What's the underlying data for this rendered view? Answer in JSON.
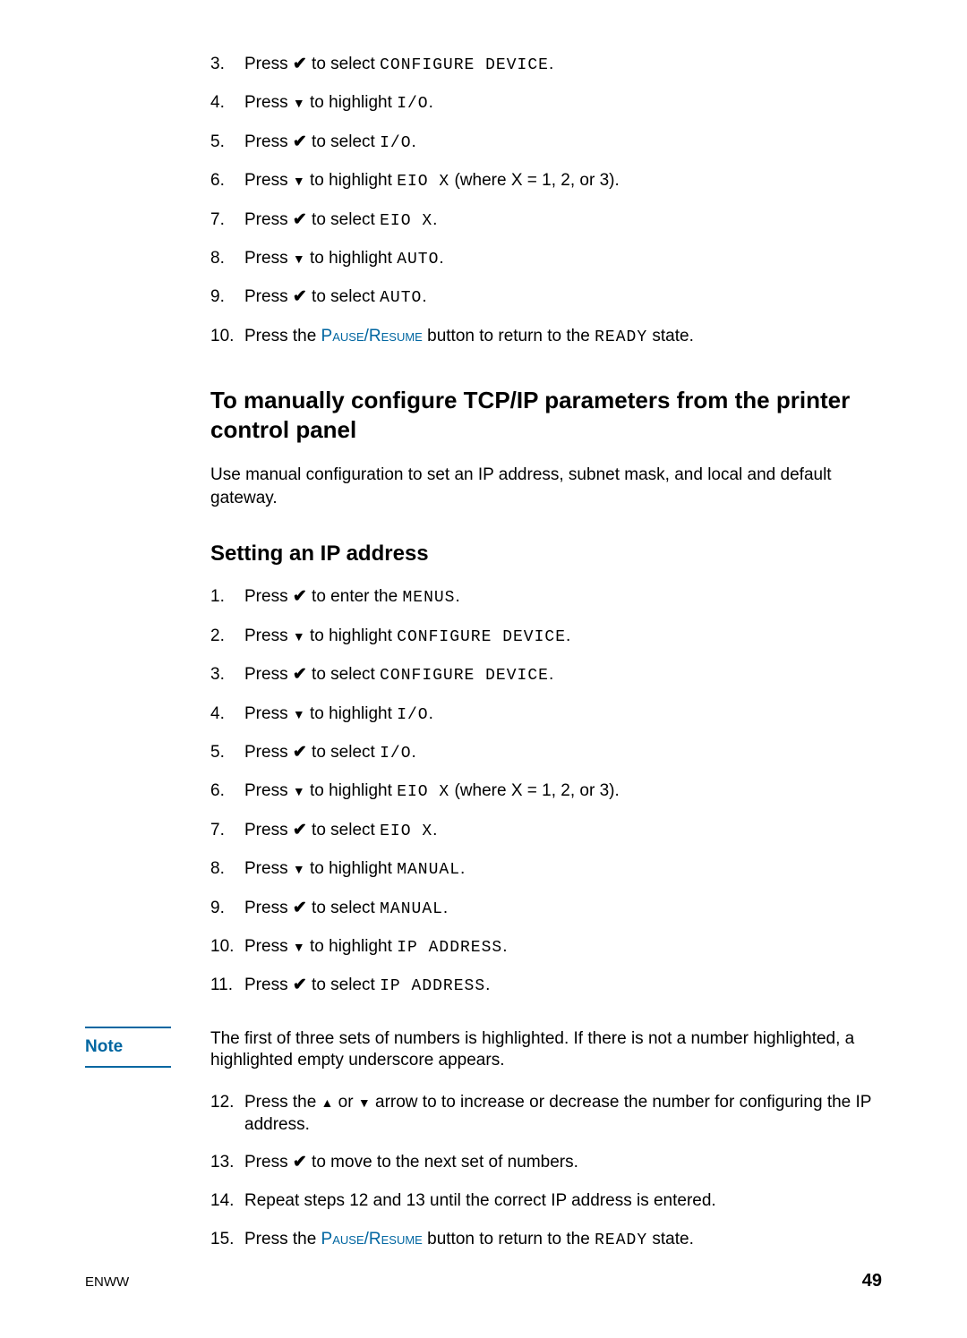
{
  "steps_a": [
    {
      "n": "3.",
      "parts": [
        "Press ",
        "CHECK",
        " to select ",
        {
          "mono": "CONFIGURE DEVICE"
        },
        "."
      ]
    },
    {
      "n": "4.",
      "parts": [
        "Press ",
        "DOWN",
        " to highlight ",
        {
          "mono": "I/O"
        },
        "."
      ]
    },
    {
      "n": "5.",
      "parts": [
        "Press ",
        "CHECK",
        " to select ",
        {
          "mono": "I/O"
        },
        "."
      ]
    },
    {
      "n": "6.",
      "parts": [
        "Press ",
        "DOWN",
        " to highlight ",
        {
          "mono": "EIO X"
        },
        " (where X = 1, 2, or 3)."
      ]
    },
    {
      "n": "7.",
      "parts": [
        "Press ",
        "CHECK",
        " to select ",
        {
          "mono": "EIO X"
        },
        "."
      ]
    },
    {
      "n": "8.",
      "parts": [
        "Press ",
        "DOWN",
        " to highlight ",
        {
          "mono": "AUTO"
        },
        "."
      ]
    },
    {
      "n": "9.",
      "parts": [
        "Press ",
        "CHECK",
        " to select ",
        {
          "mono": "AUTO"
        },
        "."
      ]
    },
    {
      "n": "10.",
      "parts": [
        "Press the ",
        {
          "sc": "Pause/Resume"
        },
        " button to return to the ",
        {
          "mono": "READY"
        },
        " state."
      ]
    }
  ],
  "section_heading": "To manually configure TCP/IP parameters from the printer control panel",
  "section_body": "Use manual configuration to set an IP address, subnet mask, and local and default gateway.",
  "subsection_heading": "Setting an IP address",
  "steps_b": [
    {
      "n": "1.",
      "parts": [
        "Press ",
        "CHECK",
        " to enter the ",
        {
          "mono": "MENUS"
        },
        "."
      ]
    },
    {
      "n": "2.",
      "parts": [
        "Press ",
        "DOWN",
        " to highlight ",
        {
          "mono": "CONFIGURE DEVICE"
        },
        "."
      ]
    },
    {
      "n": "3.",
      "parts": [
        "Press ",
        "CHECK",
        " to select ",
        {
          "mono": "CONFIGURE DEVICE"
        },
        "."
      ]
    },
    {
      "n": "4.",
      "parts": [
        "Press ",
        "DOWN",
        " to highlight ",
        {
          "mono": "I/O"
        },
        "."
      ]
    },
    {
      "n": "5.",
      "parts": [
        "Press ",
        "CHECK",
        " to select ",
        {
          "mono": "I/O"
        },
        "."
      ]
    },
    {
      "n": "6.",
      "parts": [
        "Press ",
        "DOWN",
        " to highlight ",
        {
          "mono": "EIO X"
        },
        " (where X = 1, 2, or 3)."
      ]
    },
    {
      "n": "7.",
      "parts": [
        "Press ",
        "CHECK",
        " to select ",
        {
          "mono": "EIO X"
        },
        "."
      ]
    },
    {
      "n": "8.",
      "parts": [
        "Press ",
        "DOWN",
        " to highlight ",
        {
          "mono": "MANUAL"
        },
        "."
      ]
    },
    {
      "n": "9.",
      "parts": [
        "Press ",
        "CHECK",
        " to select ",
        {
          "mono": "MANUAL"
        },
        "."
      ]
    },
    {
      "n": "10.",
      "parts": [
        "Press ",
        "DOWN",
        " to highlight ",
        {
          "mono": "IP ADDRESS"
        },
        "."
      ]
    },
    {
      "n": "11.",
      "parts": [
        "Press ",
        "CHECK",
        " to select ",
        {
          "mono": "IP ADDRESS"
        },
        "."
      ]
    }
  ],
  "note_label": "Note",
  "note_text": "The first of three sets of numbers is highlighted. If there is not a number highlighted, a highlighted empty underscore appears.",
  "steps_c": [
    {
      "n": "12.",
      "parts": [
        "Press the ",
        "UP",
        " or ",
        "DOWN",
        " arrow to to increase or decrease the number for configuring the IP address."
      ]
    },
    {
      "n": "13.",
      "parts": [
        "Press ",
        "CHECK",
        " to move to the next set of numbers."
      ]
    },
    {
      "n": "14.",
      "parts": [
        "Repeat steps 12 and 13 until the correct IP address is entered."
      ]
    },
    {
      "n": "15.",
      "parts": [
        "Press the ",
        {
          "sc": "Pause/Resume"
        },
        " button to return to the ",
        {
          "mono": "READY"
        },
        " state."
      ]
    }
  ],
  "footer_left": "ENWW",
  "footer_right": "49",
  "glyphs": {
    "CHECK": "✔",
    "DOWN": "▼",
    "UP": "▲"
  }
}
